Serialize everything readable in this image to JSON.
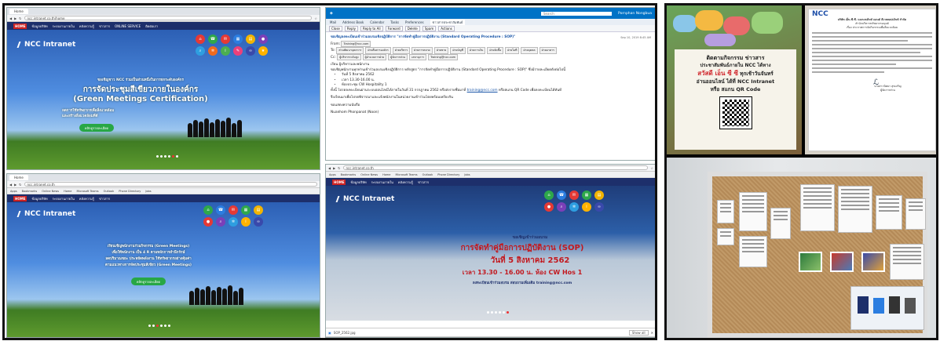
{
  "browser1": {
    "tab_title": "Home",
    "url": "ncc.intranet.co.th/home",
    "nav": [
      "HOME",
      "ข้อมูลบริษัท",
      "ระบบงานภายใน",
      "คลังความรู้",
      "ข่าวสาร",
      "ONLINE SERVICE",
      "ติดต่อเรา"
    ],
    "logo": "NCC Intranet",
    "hero_line1": "ขอเชิญชาว NCC ร่วมเป็นส่วนหนึ่งในการยกระดับองค์กร",
    "hero_title": "การจัดประชุมสีเขียวภายในองค์กร",
    "hero_subtitle": "(Green Meetings Certification)",
    "hero_line3": "ลดการใช้ทรัพยากรเพื่อสิ่งแวดล้อม",
    "hero_line4": "และสร้างสิ่งแวดล้อมที่ดี",
    "button": "คลิกดูรายละเอียด"
  },
  "browser2": {
    "tab_title": "Home",
    "url": "ncc.intranet.co.th",
    "bookmarks": [
      "Apps",
      "Bookmarks",
      "Online News",
      "Home",
      "Microsoft Teams",
      "Outlook",
      "Phone Directory",
      "Jobs"
    ],
    "logo": "NCC Intranet",
    "hero_line1": "เรียนเชิญพนักงานร่วมกิจกรรม (Green Meetings)",
    "hero_line2": "เพื่อให้พนักงาน เป็น 4 R ตามหลักการสำนึกรักษ์",
    "hero_line3": "ลดปริมาณขยะ ประหยัดพลังงาน ใช้ทรัพยากรอย่างคุ้มค่า",
    "hero_line4": "ตามแนวทางการจัดประชุมสีเขียว (Green Meetings)",
    "button": "คลิกดูรายละเอียด"
  },
  "mail": {
    "search_placeholder": "Search",
    "user": "Pornphan Nongbua",
    "tabs": [
      "Mail",
      "Address Book",
      "Calendar",
      "Tasks",
      "Preferences",
      "ข่าวสารประชาสัมพันธ์"
    ],
    "toolbar": [
      "Close",
      "Reply",
      "Reply to All",
      "Forward",
      "Delete",
      "Spam",
      "Actions"
    ],
    "subject": "ขอเชิญลงทะเบียนเข้าร่วมอบรมเชิงปฏิบัติการ \"การจัดทำคู่มือการปฏิบัติงาน (Standard Operating Procedure : SOP)\"",
    "date": "Sep 10, 2019 8:45 AM",
    "from_label": "From:",
    "from": "Training@ncc.com",
    "to_label": "To:",
    "recipients": [
      "ส่วนพัฒนาบุคลากร",
      "ฝ่ายสื่อสารองค์กร",
      "ฝ่ายบริหาร",
      "ฝ่ายการตลาด",
      "ฝ่ายขาย",
      "ฝ่ายบัญชี",
      "ฝ่ายการเงิน",
      "ฝ่ายจัดซื้อ",
      "ฝ่ายไอที",
      "ฝ่ายบุคคล",
      "ฝ่ายอาคาร"
    ],
    "cc_label": "Cc:",
    "cc": [
      "ผู้บริหารระดับสูง",
      "ผู้อำนวยการฝ่าย",
      "ผู้จัดการส่วน",
      "เลขานุการ",
      "Training@ncc.com"
    ],
    "greeting": "เรียน ผู้บริหารและพนักงาน",
    "body1": "ขอเชิญพนักงานทุกท่านเข้าร่วมอบรมเชิงปฏิบัติการ หลักสูตร \"การจัดทำคู่มือการปฏิบัติงาน (Standard Operating Procedure : SOP)\" ซึ่งมีรายละเอียดดังต่อไปนี้",
    "bullets": [
      "วันที่ 5 สิงหาคม 2562",
      "เวลา 13.30-16.00 น.",
      "ห้องประชุม CW Hospitality 1"
    ],
    "body2": "ทั้งนี้ โปรดลงทะเบียนผ่านระบบออนไลน์ได้ภายในวันที่ 31 กรกฎาคม 2562 หรือส่งรายชื่อมาที่",
    "link": "training@ncc.com",
    "body2b": "หรือสแกน QR Code เพื่อลงทะเบียนได้ทันที",
    "body3": "จึงเรียนมาเพื่อโปรดพิจารณาและแจ้งพนักงานในหน่วยงานเข้าร่วมโดยพร้อมเพรียงกัน",
    "closing": "ขอแสดงความนับถือ",
    "signature": "Nuanhom Phonpanat (Noon)"
  },
  "browser3": {
    "url": "ncc.intranet.co.th",
    "bookmarks": [
      "Apps",
      "Bookmarks",
      "Online News",
      "Home",
      "Microsoft Teams",
      "Outlook",
      "Phone Directory",
      "Jobs"
    ],
    "logo": "NCC Intranet",
    "hero_line1": "ขอเชิญเข้าร่วมอบรม",
    "hero_title": "การจัดทำคู่มือการปฏิบัติงาน (SOP)",
    "hero_date": "วันที่ 5 สิงหาคม 2562",
    "hero_time": "เวลา 13.30 - 16.00 น. ห้อง CW Hos 1",
    "hero_reg": "ลงทะเบียนเข้าร่วมอบรม สอบถามเพิ่มเติม training@ncc.com",
    "download": "SOP_2562.jpg",
    "show_all": "Show all"
  },
  "poster": {
    "line1": "ติดตามกิจกรรม ข่าวสาร",
    "line2": "ประชาสัมพันธ์ภายใน NCC ได้ทาง",
    "line3_highlight": "สวัสดี เอ็น ซี ซี",
    "line3_rest": "ทุกเช้าวันจันทร์",
    "line4": "อ่านออนไลน์ ได้ที่ NCC Intranet",
    "line5": "หรือ สแกน QR Code"
  },
  "letter": {
    "logo": "NCC",
    "heading": "บริษัท เอ็น.ซี.ซี. แมเนจเม้นท์ แอนด์ ดีเวลลอปเม้นท์ จำกัด",
    "heading2": "สำนักบริหารทรัพยากรมนุษย์",
    "heading3": "เรื่อง ประกาศการจัดกิจกรรมเพื่อสิ่งแวดล้อม",
    "signer": "นางสาวนิตยา สุขเจริญ",
    "signer_title": "ผู้จัดการส่วน"
  },
  "colors": {
    "intranet_nav": "#1d2f6b",
    "outlook_blue": "#0072c6",
    "green_button": "#28a745",
    "poster_red": "#d0262c",
    "cork": "#b48a58"
  },
  "icons": [
    "home-icon",
    "phone-icon",
    "mail-icon",
    "calendar-icon",
    "document-icon",
    "user-icon",
    "search-icon",
    "gear-icon",
    "info-icon",
    "chat-icon",
    "link-icon",
    "star-icon"
  ]
}
